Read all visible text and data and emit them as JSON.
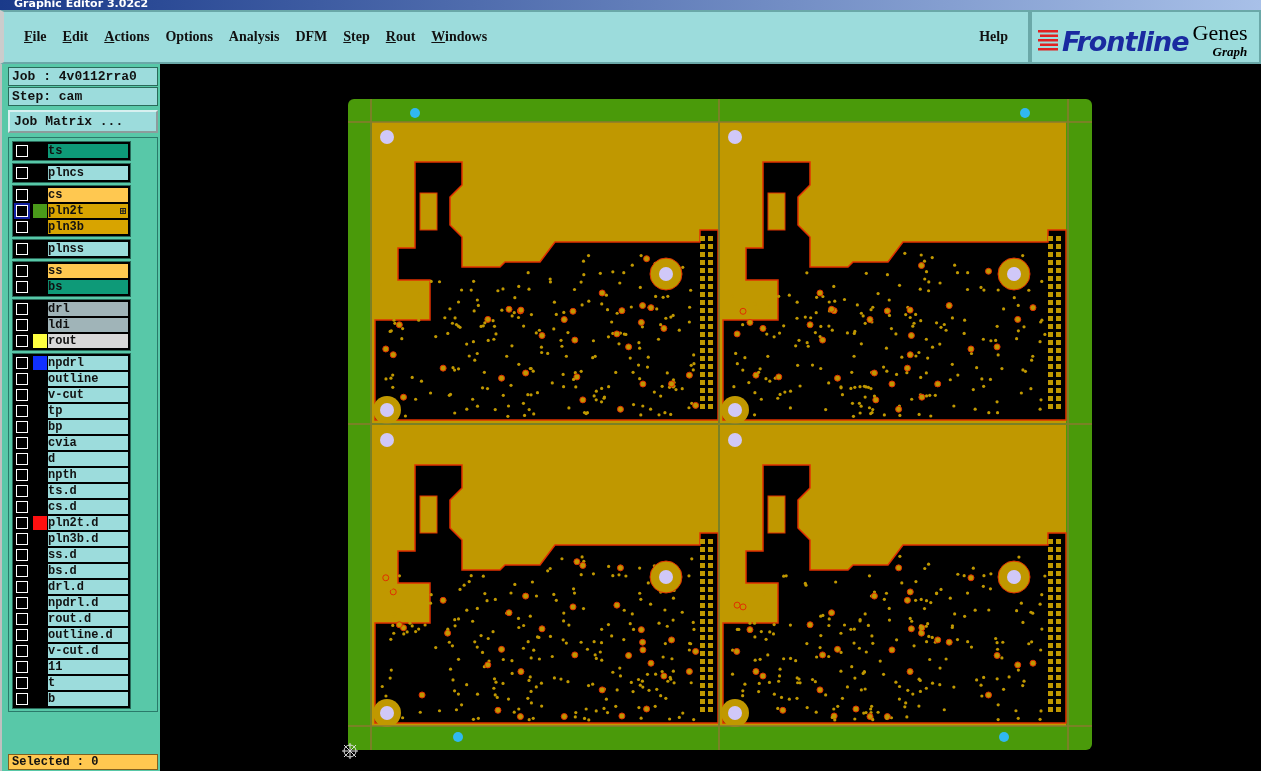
{
  "window": {
    "title": "Graphic Editor 3.02c2"
  },
  "menu": [
    {
      "label": "File",
      "mnemonic": true
    },
    {
      "label": "Edit",
      "mnemonic": true
    },
    {
      "label": "Actions",
      "mnemonic": true
    },
    {
      "label": "Options",
      "mnemonic": false
    },
    {
      "label": "Analysis",
      "mnemonic": false
    },
    {
      "label": "DFM",
      "mnemonic": false
    },
    {
      "label": "Step",
      "mnemonic": true
    },
    {
      "label": "Rout",
      "mnemonic": true
    },
    {
      "label": "Windows",
      "mnemonic": true
    }
  ],
  "help": {
    "label": "Help"
  },
  "logo": {
    "brand": "Frontline",
    "product": "Genes",
    "subtitle": "Graph"
  },
  "job": {
    "job": "Job : 4v0112rra0",
    "step": "Step: cam",
    "matrix_button": "Job Matrix ..."
  },
  "layer_groups": [
    [
      {
        "name": "ts",
        "color": "#0e9a78",
        "checked": false,
        "focused": false
      }
    ],
    [
      {
        "name": "plncs",
        "color": "#9cdcdc",
        "checked": false,
        "focused": false
      }
    ],
    [
      {
        "name": "cs",
        "color": "#ffc850",
        "checked": false,
        "focused": false
      },
      {
        "name": "pln2t",
        "color": "#d8a400",
        "swatch": {
          "color": "#4a9a1a"
        },
        "checked": false,
        "focused": true
      },
      {
        "name": "pln3b",
        "color": "#d8a400",
        "checked": false,
        "focused": false
      }
    ],
    [
      {
        "name": "plnss",
        "color": "#9cdcdc",
        "checked": false,
        "focused": false
      }
    ],
    [
      {
        "name": "ss",
        "color": "#ffc850",
        "checked": false,
        "focused": false
      },
      {
        "name": "bs",
        "color": "#0e9a78",
        "checked": false,
        "focused": false
      }
    ],
    [
      {
        "name": "drl",
        "color": "#a0b4b8",
        "checked": false,
        "focused": false
      },
      {
        "name": "ldi",
        "color": "#a0b4b8",
        "checked": false,
        "focused": false
      },
      {
        "name": "rout",
        "color": "#d8d8d8",
        "swatch": {
          "color": "#ffff40"
        },
        "checked": false,
        "focused": false
      }
    ],
    [
      {
        "name": "npdrl",
        "color": "#9cdcdc",
        "swatch": {
          "color": "#1030ff"
        },
        "checked": false,
        "focused": false
      },
      {
        "name": "outline",
        "color": "#9cdcdc",
        "checked": false,
        "focused": false
      },
      {
        "name": "v-cut",
        "color": "#9cdcdc",
        "checked": false,
        "focused": false
      },
      {
        "name": "tp",
        "color": "#9cdcdc",
        "checked": false,
        "focused": false
      },
      {
        "name": "bp",
        "color": "#9cdcdc",
        "checked": false,
        "focused": false
      },
      {
        "name": "cvia",
        "color": "#9cdcdc",
        "checked": false,
        "focused": false
      },
      {
        "name": "d",
        "color": "#9cdcdc",
        "checked": false,
        "focused": false
      },
      {
        "name": "npth",
        "color": "#9cdcdc",
        "checked": false,
        "focused": false
      },
      {
        "name": "ts.d",
        "color": "#9cdcdc",
        "checked": false,
        "focused": false
      },
      {
        "name": "cs.d",
        "color": "#9cdcdc",
        "checked": false,
        "focused": false
      },
      {
        "name": "pln2t.d",
        "color": "#9cdcdc",
        "swatch": {
          "color": "#ff1010"
        },
        "checked": false,
        "focused": false
      },
      {
        "name": "pln3b.d",
        "color": "#9cdcdc",
        "checked": false,
        "focused": false
      },
      {
        "name": "ss.d",
        "color": "#9cdcdc",
        "checked": false,
        "focused": false
      },
      {
        "name": "bs.d",
        "color": "#9cdcdc",
        "checked": false,
        "focused": false
      },
      {
        "name": "drl.d",
        "color": "#9cdcdc",
        "checked": false,
        "focused": false
      },
      {
        "name": "npdrl.d",
        "color": "#9cdcdc",
        "checked": false,
        "focused": false
      },
      {
        "name": "rout.d",
        "color": "#9cdcdc",
        "checked": false,
        "focused": false
      },
      {
        "name": "outline.d",
        "color": "#9cdcdc",
        "checked": false,
        "focused": false
      },
      {
        "name": "v-cut.d",
        "color": "#9cdcdc",
        "checked": false,
        "focused": false
      },
      {
        "name": "11",
        "color": "#9cdcdc",
        "checked": false,
        "focused": false
      },
      {
        "name": "t",
        "color": "#9cdcdc",
        "checked": false,
        "focused": false
      },
      {
        "name": "b",
        "color": "#9cdcdc",
        "checked": false,
        "focused": false
      }
    ]
  ],
  "status": {
    "selected": "Selected : 0"
  }
}
